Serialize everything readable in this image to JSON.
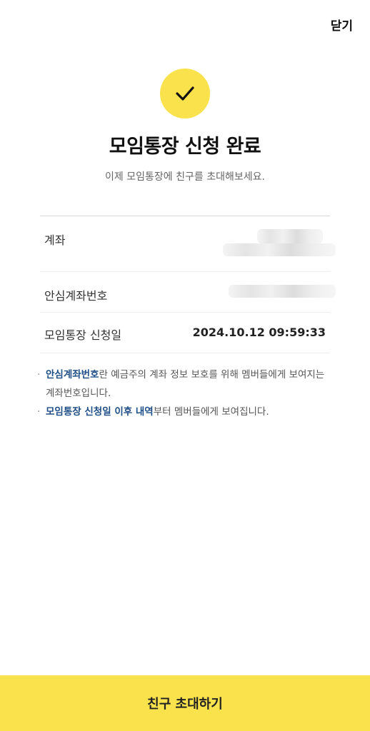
{
  "header": {
    "close_label": "닫기"
  },
  "result": {
    "title": "모임통장 신청 완료",
    "subtitle": "이제 모임통장에 친구를 초대해보세요."
  },
  "info": {
    "account_label": "계좌",
    "safe_number_label": "안심계좌번호",
    "date_label": "모임통장 신청일",
    "date_value": "2024.10.12 09:59:33"
  },
  "notes": {
    "note1_highlight": "안심계좌번호",
    "note1_rest": "란 예금주의 계좌 정보 보호를 위해 멤버들에게 보여지는 계좌번호입니다.",
    "note2_highlight": "모임통장 신청일 이후 내역",
    "note2_rest": "부터 멤버들에게 보여집니다."
  },
  "footer": {
    "invite_label": "친구 초대하기"
  },
  "colors": {
    "accent": "#fae24c",
    "highlight": "#1f4f86"
  },
  "icons": {
    "status": "check-icon"
  }
}
